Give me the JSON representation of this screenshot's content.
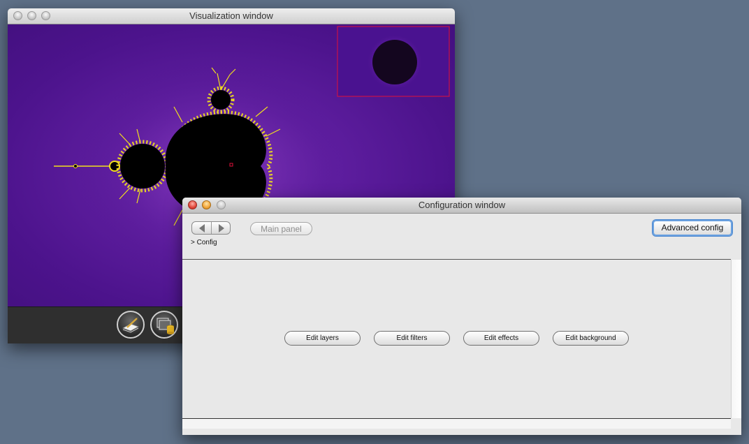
{
  "visualization_window": {
    "title": "Visualization window"
  },
  "configuration_window": {
    "title": "Configuration window",
    "main_panel_label": "Main panel",
    "breadcrumb": "> Config",
    "advanced_config_label": "Advanced config",
    "buttons": [
      {
        "label": "Edit layers"
      },
      {
        "label": "Edit filters"
      },
      {
        "label": "Edit effects"
      },
      {
        "label": "Edit background"
      }
    ]
  },
  "colors": {
    "fractal_background": "#4c138c",
    "fractal_set": "#000000",
    "fractal_edge": "#f2e01c",
    "minimap_frame": "#e0103a",
    "focus_ring": "#6aa1e0"
  },
  "icons": {
    "toolbar_left": "pen-on-paper-icon",
    "toolbar_right": "layers-database-icon"
  }
}
